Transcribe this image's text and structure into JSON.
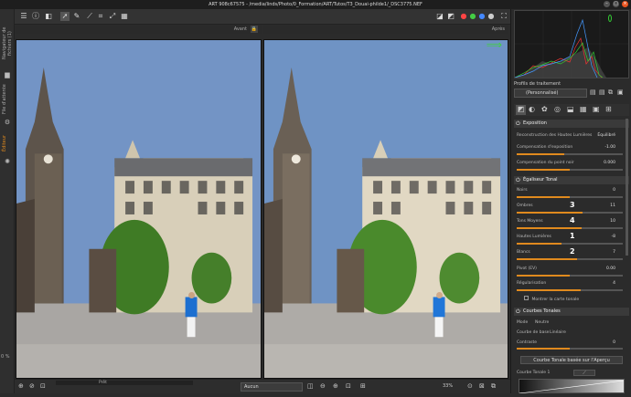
{
  "window": {
    "title": "ART 908c67575 - /media/linds/Photo/0_Formation/ART/Tutos/T3_Douai-philde1/_DSC3775.NEF"
  },
  "side_tabs": {
    "browser": "Navigateur de fichiers (1)",
    "queue": "File d'attente",
    "editor": "Éditeur",
    "zoom_left": "0 %"
  },
  "viewer": {
    "before_label": "Avant",
    "after_label": "Après",
    "preview_label": "Prêt",
    "zoom": "33%",
    "bg_select": "Aucun"
  },
  "colors": {
    "accent": "#e08a1e",
    "sky": "#6f93c4",
    "panel": "#2b2b2b"
  },
  "processing": {
    "header": "Profils de traitement",
    "selected": "(Personnalisé)"
  },
  "exposure": {
    "title": "Exposition",
    "hl_reconstruction_label": "Reconstruction des Hautes Lumières",
    "hl_reconstruction_value": "Équilibré",
    "comp_label": "Compensation d'exposition",
    "comp_value": "-1.00",
    "black_label": "Compensation du point noir",
    "black_value": "0.000"
  },
  "tone_eq": {
    "title": "Égaliseur Tonal",
    "bands": [
      {
        "label": "Noirs",
        "value": "0",
        "level": 0.5
      },
      {
        "label": "Ombres",
        "value": "11",
        "level": 0.62
      },
      {
        "label": "Tons Moyens",
        "value": "10",
        "level": 0.61
      },
      {
        "label": "Hautes Lumières",
        "value": "-8",
        "level": 0.42
      },
      {
        "label": "Blancs",
        "value": "7",
        "level": 0.57
      }
    ],
    "pivot_label": "Pivot (EV)",
    "pivot_value": "0.00",
    "reg_label": "Régularisation",
    "reg_value": "4",
    "show_map_label": "Montrer la carte tonale"
  },
  "curves": {
    "title": "Courbes Tonales",
    "mode_label": "Mode",
    "mode_value": "Neutre",
    "base_label": "Courbe de base",
    "base_value": "Linéaire",
    "contrast_label": "Contraste",
    "contrast_value": "0",
    "preview_button": "Courbe Tonale basée sur l'Aperçu",
    "curve1_label": "Courbe Tonale 1"
  },
  "annotations": {
    "shadows": "3",
    "midtones": "4",
    "highlights": "1",
    "whites": "2",
    "arrow": "⟹"
  }
}
